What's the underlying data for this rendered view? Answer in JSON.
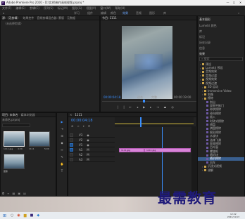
{
  "window": {
    "title": "Adobe Premiere Pro 2020 - D:\\实例\\制作高帧视频.prproj *",
    "app_badge": "Pr"
  },
  "menu": [
    "文件(F)",
    "编辑(E)",
    "剪辑(C)",
    "序列(S)",
    "标记(M)",
    "图形(G)",
    "视图(V)",
    "窗口(W)",
    "帮助(H)"
  ],
  "workspaces": [
    "学习",
    "组件",
    "编辑",
    "颜色",
    "效果",
    "音频",
    "图形",
    "库"
  ],
  "source_panel": {
    "tabs": [
      "源:（无剪辑）",
      "效果控件",
      "音频剪辑混合器: 蒙版",
      "元数据"
    ],
    "empty_label": "（未选择剪辑）"
  },
  "program_panel": {
    "tab": "节目: 1111",
    "timecode_left": "00:00:04:18",
    "fit": "适合",
    "quality": "完整",
    "timecode_right": "00:00:19:00"
  },
  "project_panel": {
    "tabs": [
      "项目: 未命名",
      "媒体浏览器",
      "库",
      "信息"
    ],
    "project_name": "未命名.prproj",
    "items": [
      {
        "name": "1111.jpg",
        "duration": "4:29"
      },
      {
        "name": "1111",
        "duration": "5:00"
      }
    ],
    "extra_name": "图像"
  },
  "timeline": {
    "tab": "1111",
    "timecode": "00:00:04:18",
    "video_tracks": [
      "V3",
      "V2",
      "V1"
    ],
    "audio_tracks": [
      "A1",
      "A2",
      "A3"
    ],
    "clip_a": "1111.jpg",
    "clip_b": "1111.jpg"
  },
  "effects_panel": {
    "header": "基本图形",
    "tabs": [
      "Lumetri 颜色",
      "库",
      "标记",
      "历史记录",
      "信息",
      "效果"
    ],
    "search_label": "搜索",
    "items": [
      {
        "label": "预设",
        "indent": 1,
        "type": "folder"
      },
      {
        "label": "Lumetri 预设",
        "indent": 1,
        "type": "folder"
      },
      {
        "label": "音频效果",
        "indent": 1,
        "type": "folder"
      },
      {
        "label": "音频过渡",
        "indent": 1,
        "type": "folder"
      },
      {
        "label": "视频效果",
        "indent": 1,
        "type": "folder"
      },
      {
        "label": "视频过渡",
        "indent": 1,
        "type": "folder"
      },
      {
        "label": "3D 运动",
        "indent": 2,
        "type": "folder"
      },
      {
        "label": "Immersive Video",
        "indent": 2,
        "type": "folder"
      },
      {
        "label": "划像",
        "indent": 2,
        "type": "folder"
      },
      {
        "label": "擦除",
        "indent": 2,
        "type": "folder"
      },
      {
        "label": "划出",
        "indent": 3,
        "type": "fx"
      },
      {
        "label": "双侧平推门",
        "indent": 3,
        "type": "fx"
      },
      {
        "label": "带状擦除",
        "indent": 3,
        "type": "fx"
      },
      {
        "label": "径向擦除",
        "indent": 3,
        "type": "fx"
      },
      {
        "label": "插入",
        "indent": 3,
        "type": "fx"
      },
      {
        "label": "时钟式擦除",
        "indent": 3,
        "type": "fx"
      },
      {
        "label": "棋盘",
        "indent": 3,
        "type": "fx"
      },
      {
        "label": "棋盘擦除",
        "indent": 3,
        "type": "fx"
      },
      {
        "label": "楔形擦除",
        "indent": 3,
        "type": "fx"
      },
      {
        "label": "水波块",
        "indent": 3,
        "type": "fx"
      },
      {
        "label": "油漆飞溅",
        "indent": 3,
        "type": "fx"
      },
      {
        "label": "渐变擦除",
        "indent": 3,
        "type": "fx"
      },
      {
        "label": "百叶窗",
        "indent": 3,
        "type": "fx"
      },
      {
        "label": "螺旋框",
        "indent": 3,
        "type": "fx"
      },
      {
        "label": "随机块",
        "indent": 3,
        "type": "fx"
      },
      {
        "label": "随机擦除",
        "indent": 3,
        "type": "fx",
        "selected": true
      },
      {
        "label": "风车",
        "indent": 3,
        "type": "fx"
      },
      {
        "label": "沉浸式视频",
        "indent": 2,
        "type": "folder"
      },
      {
        "label": "溶解",
        "indent": 2,
        "type": "folder"
      }
    ]
  },
  "taskbar": {
    "time": "12:22",
    "date": "2021/11/13"
  },
  "watermark": "最需教育",
  "colors": {
    "accent": "#3a8fff",
    "clip": "#d884d8",
    "selection": "#3a5f8f"
  }
}
